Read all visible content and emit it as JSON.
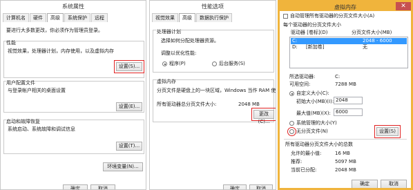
{
  "sysprops": {
    "title": "系统属性",
    "tabs": [
      "计算机名",
      "硬件",
      "高级",
      "系统保护",
      "远程"
    ],
    "admin_note": "要进行大多数更改，你必须作为管理员登录。",
    "perf_group": "性能",
    "perf_desc": "视觉效果，处理器计划，内存使用，以及虚拟内存",
    "perf_btn": "设置(S)...",
    "profile_group": "用户配置文件",
    "profile_desc": "与登录帐户相关的桌面设置",
    "profile_btn": "设置(E)...",
    "startup_group": "启动和故障恢复",
    "startup_desc": "系统启动、系统故障和调试信息",
    "startup_btn": "设置(T)...",
    "env_btn": "环境变量(N)...",
    "ok": "确定",
    "cancel": "取消"
  },
  "perfopts": {
    "title": "性能选项",
    "tabs": [
      "视觉效果",
      "高级",
      "数据执行保护"
    ],
    "cpu_group": "处理器计划",
    "cpu_desc": "选择如何分配处理器资源。",
    "adjust_label": "调整以优化性能:",
    "radio_programs": "程序(P)",
    "radio_background": "后台服务(S)",
    "vm_group": "虚拟内存",
    "vm_desc": "分页文件是硬盘上的一块区域，Windows 当作 RAM 使用。",
    "total_label": "所有驱动器总分页文件大小:",
    "total_value": "2048 MB",
    "change_btn": "更改(C)...",
    "ok": "确定",
    "cancel": "取消"
  },
  "vmem": {
    "title": "虚拟内存",
    "auto_manage": "自动管理所有驱动器的分页文件大小(A)",
    "per_drive_label": "每个驱动器的分页文件大小",
    "col_drive": "驱动器 [卷标](D)",
    "col_size": "分页文件大小(MB)",
    "drives": [
      {
        "drive": "C:",
        "label": "",
        "size": "2048 - 6000"
      },
      {
        "drive": "D:",
        "label": "[新加卷]",
        "size": "无"
      }
    ],
    "selected_drive_label": "所选驱动器:",
    "selected_drive_value": "C:",
    "free_space_label": "可用空间:",
    "free_space_value": "7288 MB",
    "custom_size": "自定义大小(C):",
    "initial_label": "初始大小(MB)(I):",
    "initial_value": "2048",
    "max_label": "最大值(MB)(X):",
    "max_value": "6000",
    "system_managed": "系统管理的大小(Y)",
    "no_pagefile": "无分页文件(N)",
    "set_btn": "设置(S)",
    "totals_label": "所有驱动器分页文件大小的总数",
    "min_allowed_label": "允许的最小值:",
    "min_allowed_value": "16 MB",
    "recommended_label": "推荐:",
    "recommended_value": "5097 MB",
    "current_label": "当前已分配:",
    "current_value": "2048 MB",
    "ok": "确定",
    "cancel": "取消",
    "accent": "#f0b43c"
  }
}
